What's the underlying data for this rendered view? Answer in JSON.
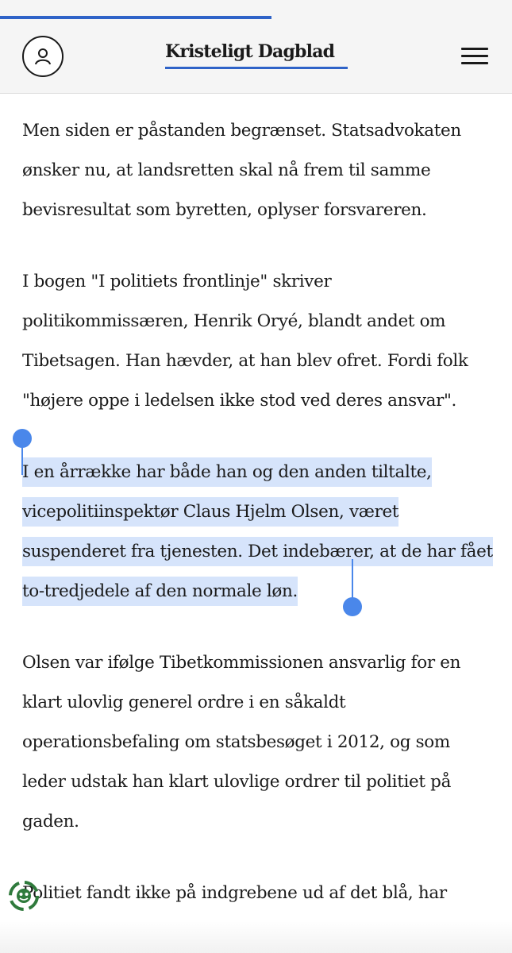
{
  "header": {
    "logo_text": "Kristeligt Dagblad",
    "account_icon": "user-icon",
    "menu_icon": "hamburger-menu-icon",
    "reading_progress_percent": 53,
    "accent_color": "#2f63c8"
  },
  "article": {
    "paragraphs": [
      "Men siden er påstanden begrænset. Statsadvokaten ønsker nu, at landsretten skal nå frem til samme bevisresultat som byretten, oplyser forsvareren.",
      "I bogen \"I politiets frontlinje\" skriver politikommissæren, Henrik Oryé, blandt andet om Tibetsagen. Han hævder, at han blev ofret. Fordi folk \"højere oppe i ledelsen ikke stod ved deres ansvar\".",
      "I en årrække har både han og den anden tiltalte, vicepolitiinspektør Claus Hjelm Olsen, været suspenderet fra tjenesten. Det indebærer, at de har fået to-tredjedele af den normale løn.",
      "Olsen var ifølge Tibetkommissionen ansvarlig for en klart ulovlig generel ordre i en såkaldt operationsbefaling om statsbesøget i 2012, og som leder udstak han klart ulovlige ordrer til politiet på gaden.",
      "Politiet fandt ikke på indgrebene ud af det blå, har"
    ],
    "selected_paragraph_index": 2,
    "selection_color": "#d6e4fb",
    "handle_color": "#4a87ea"
  },
  "widgets": {
    "floating_icon": "recycle-assistant-icon"
  }
}
